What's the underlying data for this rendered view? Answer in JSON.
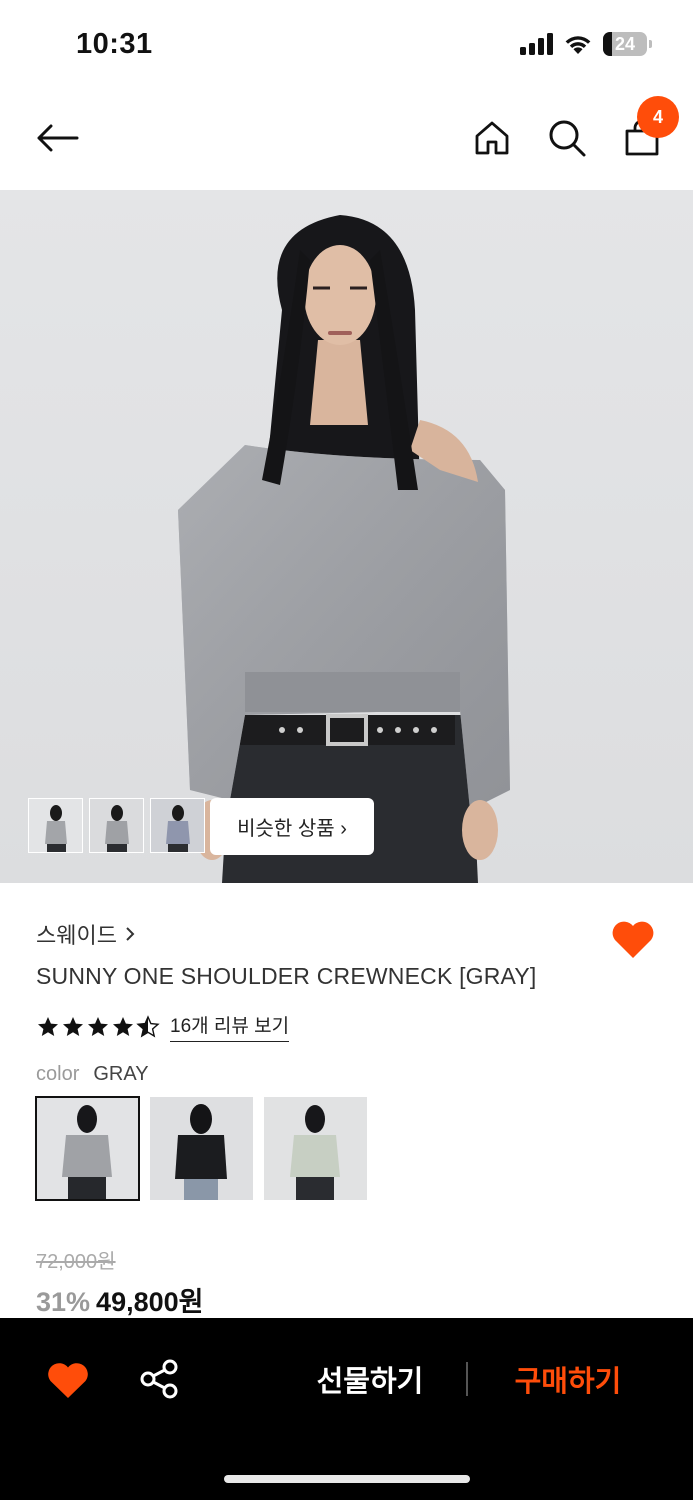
{
  "status_bar": {
    "time": "10:31",
    "battery": "24"
  },
  "nav": {
    "cart_count": "4"
  },
  "hero": {
    "similar_label": "비슷한 상품 ›"
  },
  "product": {
    "brand": "스웨이드",
    "name": "SUNNY ONE SHOULDER CREWNECK [GRAY]",
    "rating": 4.5,
    "review_link": "16개 리뷰 보기",
    "color_label": "color",
    "color_value": "GRAY",
    "original_price": "72,000원",
    "discount": "31%",
    "price": "49,800원",
    "wishlisted": true
  },
  "bottom_bar": {
    "gift_label": "선물하기",
    "buy_label": "구매하기"
  },
  "colors": {
    "accent": "#ff4d0a"
  }
}
